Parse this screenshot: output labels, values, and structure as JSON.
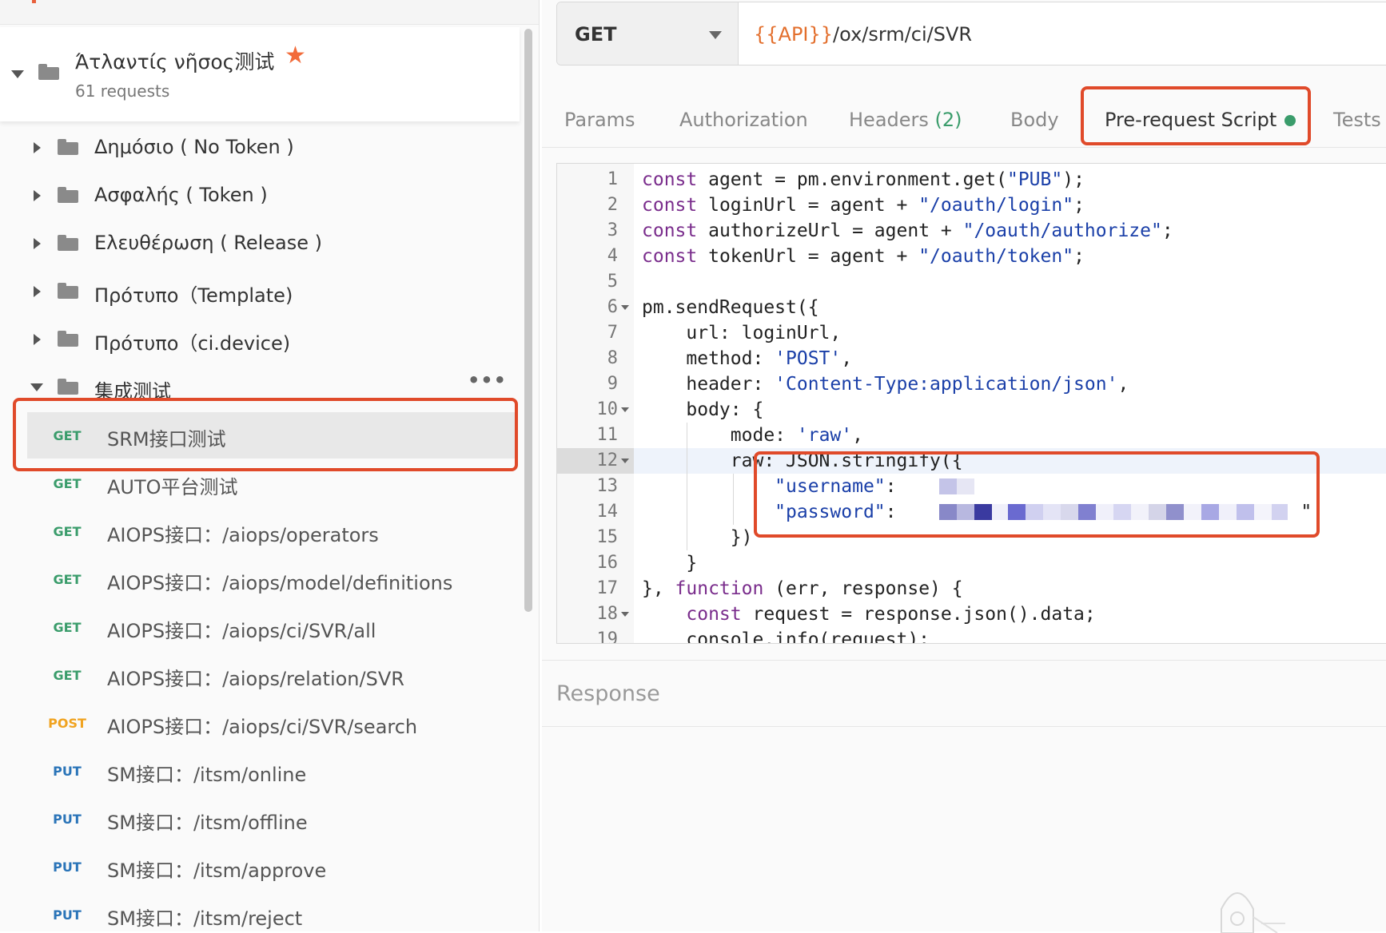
{
  "sidebar": {
    "collection": {
      "name": "Άτλαντίς νῆσος测试",
      "count": "61 requests"
    },
    "folders": [
      {
        "name": "Δημόσιο ( No Token )"
      },
      {
        "name": "Ασφαλής ( Token )"
      },
      {
        "name": "Ελευθέρωση ( Release )"
      },
      {
        "name": "Πρότυπο（Template)"
      },
      {
        "name": "Πρότυπο（ci.device)"
      },
      {
        "name": "集成测试"
      }
    ],
    "more_icon": "•••",
    "requests": [
      {
        "method": "GET",
        "name": "SRM接口测试"
      },
      {
        "method": "GET",
        "name": "AUTO平台测试"
      },
      {
        "method": "GET",
        "name": "AIOPS接口：/aiops/operators"
      },
      {
        "method": "GET",
        "name": "AIOPS接口：/aiops/model/definitions"
      },
      {
        "method": "GET",
        "name": "AIOPS接口：/aiops/ci/SVR/all"
      },
      {
        "method": "GET",
        "name": "AIOPS接口：/aiops/relation/SVR"
      },
      {
        "method": "POST",
        "name": "AIOPS接口：/aiops/ci/SVR/search"
      },
      {
        "method": "PUT",
        "name": "SM接口：/itsm/online"
      },
      {
        "method": "PUT",
        "name": "SM接口：/itsm/offline"
      },
      {
        "method": "PUT",
        "name": "SM接口：/itsm/approve"
      },
      {
        "method": "PUT",
        "name": "SM接口：/itsm/reject"
      }
    ]
  },
  "request": {
    "method": "GET",
    "url_variable": "{{API}}",
    "url_path": "/ox/srm/ci/SVR"
  },
  "tabs": [
    {
      "label": "Params"
    },
    {
      "label": "Authorization"
    },
    {
      "label": "Headers",
      "count": "(2)"
    },
    {
      "label": "Body"
    },
    {
      "label": "Pre-request Script"
    },
    {
      "label": "Tests"
    }
  ],
  "editor": {
    "line_numbers": [
      "1",
      "2",
      "3",
      "4",
      "5",
      "6",
      "7",
      "8",
      "9",
      "10",
      "11",
      "12",
      "13",
      "14",
      "15",
      "16",
      "17",
      "18",
      "19"
    ],
    "lines": {
      "l1": {
        "a": "const ",
        "b": "agent = pm.environment.get(",
        "c": "\"PUB\"",
        "d": ");"
      },
      "l2": {
        "a": "const ",
        "b": "loginUrl = agent + ",
        "c": "\"/oauth/login\"",
        "d": ";"
      },
      "l3": {
        "a": "const ",
        "b": "authorizeUrl = agent + ",
        "c": "\"/oauth/authorize\"",
        "d": ";"
      },
      "l4": {
        "a": "const ",
        "b": "tokenUrl = agent + ",
        "c": "\"/oauth/token\"",
        "d": ";"
      },
      "l6": {
        "b": "pm.sendRequest({"
      },
      "l7": {
        "b": "    url: loginUrl,"
      },
      "l8": {
        "b": "    method: ",
        "c": "'POST'",
        "d": ","
      },
      "l9": {
        "b": "    header: ",
        "c": "'Content-Type:application/json'",
        "d": ","
      },
      "l10": {
        "b": "    body: {"
      },
      "l11": {
        "b": "        mode: ",
        "c": "'raw'",
        "d": ","
      },
      "l12": {
        "b": "        raw: JSON.stringify({"
      },
      "l13": {
        "c": "            \"username\"",
        "d": ": ",
        "e": "',"
      },
      "l14": {
        "c": "            \"password\"",
        "d": ": ",
        "e": "\""
      },
      "l15": {
        "b": "        })"
      },
      "l16": {
        "b": "    }"
      },
      "l17": {
        "b": "}, ",
        "a": "function",
        "d": " (err, response) {"
      },
      "l18": {
        "a": "    const ",
        "b": "request = response.json().data;"
      },
      "l19": {
        "b": "    console.info(request);"
      }
    }
  },
  "response": {
    "label": "Response"
  },
  "colors": {
    "accent_orange": "#e04a2a",
    "get_green": "#3a9c6b",
    "post_orange": "#f0a320",
    "put_blue": "#2a74b8",
    "keyword_purple": "#7a2d8c",
    "string_blue": "#1a3fa8"
  },
  "icons": {
    "collection": "folder-icon",
    "favorite": "star-icon",
    "status": "green-dot-icon"
  }
}
